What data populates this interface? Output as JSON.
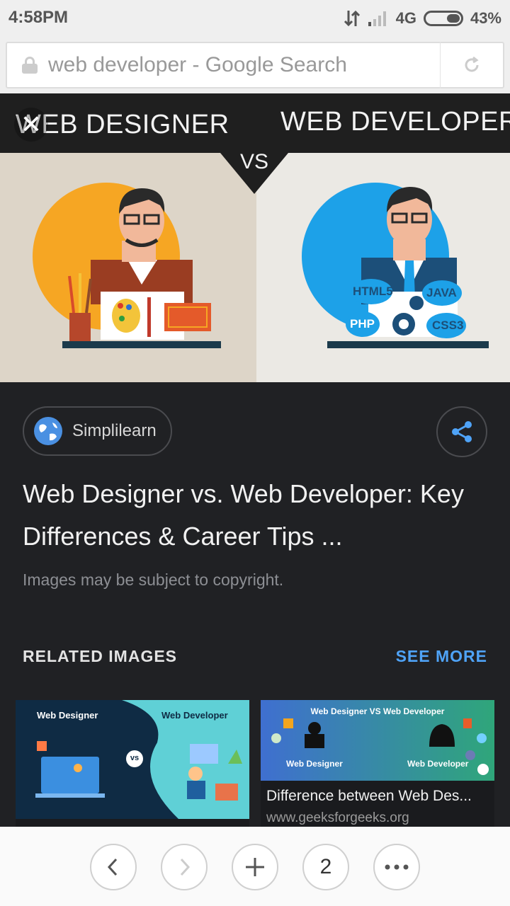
{
  "status_bar": {
    "time": "4:58PM",
    "network": "4G",
    "battery": "43%"
  },
  "address_bar": {
    "text": "web developer - Google Search",
    "lock_icon": "lock-icon",
    "reload_icon": "reload-icon"
  },
  "hero": {
    "left_title": "WEB DESIGNER",
    "right_title": "WEB DEVELOPER",
    "vs_label": "VS",
    "tech_labels": [
      "HTML5",
      "JAVA",
      "PHP",
      "CSS3"
    ],
    "close_icon": "close-icon"
  },
  "result": {
    "source": "Simplilearn",
    "title": "Web Designer vs. Web Developer: Key Differences & Career Tips ...",
    "copyright": "Images may be subject to copyright."
  },
  "related": {
    "heading": "RELATED IMAGES",
    "see_more": "SEE MORE",
    "items": [
      {
        "left_label": "Web Designer",
        "right_label": "Web Developer",
        "vs": "vs"
      },
      {
        "banner": "Web Designer VS Web Developer",
        "left_label": "Web Designer",
        "right_label": "Web Developer",
        "caption": "Difference between Web Des...",
        "site": "www.geeksforgeeks.org"
      }
    ]
  },
  "bottom_nav": {
    "tab_count": "2"
  },
  "colors": {
    "dark_bg": "#202124",
    "accent": "#4fa3f7",
    "orange": "#f6a623",
    "blue": "#1da1e8"
  }
}
